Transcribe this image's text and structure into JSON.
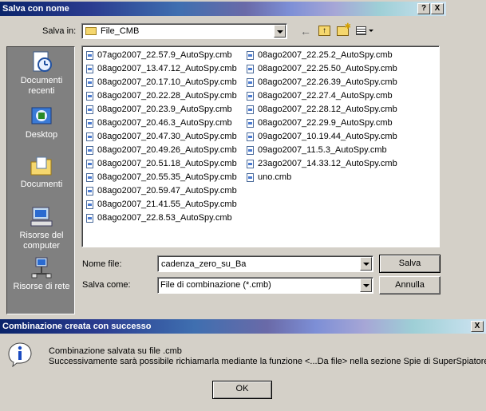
{
  "save_dialog": {
    "title": "Salva con nome",
    "help_btn": "?",
    "close_btn": "X",
    "save_in_label": "Salva in:",
    "save_in_value": "File_CMB",
    "places": [
      {
        "label": "Documenti recenti",
        "icon": "recent-documents-icon"
      },
      {
        "label": "Desktop",
        "icon": "desktop-icon"
      },
      {
        "label": "Documenti",
        "icon": "documents-folder-icon"
      },
      {
        "label": "Risorse del computer",
        "icon": "my-computer-icon"
      },
      {
        "label": "Risorse di rete",
        "icon": "network-icon"
      }
    ],
    "files_col1": [
      "07ago2007_22.57.9_AutoSpy.cmb",
      "08ago2007_13.47.12_AutoSpy.cmb",
      "08ago2007_20.17.10_AutoSpy.cmb",
      "08ago2007_20.22.28_AutoSpy.cmb",
      "08ago2007_20.23.9_AutoSpy.cmb",
      "08ago2007_20.46.3_AutoSpy.cmb",
      "08ago2007_20.47.30_AutoSpy.cmb",
      "08ago2007_20.49.26_AutoSpy.cmb",
      "08ago2007_20.51.18_AutoSpy.cmb",
      "08ago2007_20.55.35_AutoSpy.cmb",
      "08ago2007_20.59.47_AutoSpy.cmb",
      "08ago2007_21.41.55_AutoSpy.cmb",
      "08ago2007_22.8.53_AutoSpy.cmb"
    ],
    "files_col2": [
      "08ago2007_22.25.2_AutoSpy.cmb",
      "08ago2007_22.25.50_AutoSpy.cmb",
      "08ago2007_22.26.39_AutoSpy.cmb",
      "08ago2007_22.27.4_AutoSpy.cmb",
      "08ago2007_22.28.12_AutoSpy.cmb",
      "08ago2007_22.29.9_AutoSpy.cmb",
      "09ago2007_10.19.44_AutoSpy.cmb",
      "09ago2007_11.5.3_AutoSpy.cmb",
      "23ago2007_14.33.12_AutoSpy.cmb",
      "uno.cmb"
    ],
    "filename_label": "Nome file:",
    "filename_value": "cadenza_zero_su_Ba",
    "filetype_label": "Salva come:",
    "filetype_value": "File di combinazione (*.cmb)",
    "save_button": "Salva",
    "cancel_button": "Annulla"
  },
  "message_box": {
    "title": "Combinazione creata con successo",
    "close_btn": "X",
    "line1": "Combinazione salvata su file .cmb",
    "line2": "Successivamente sarà possibile richiamarla mediante la funzione <...Da file> nella sezione Spie di SuperSpiatore.",
    "ok_button": "OK"
  }
}
